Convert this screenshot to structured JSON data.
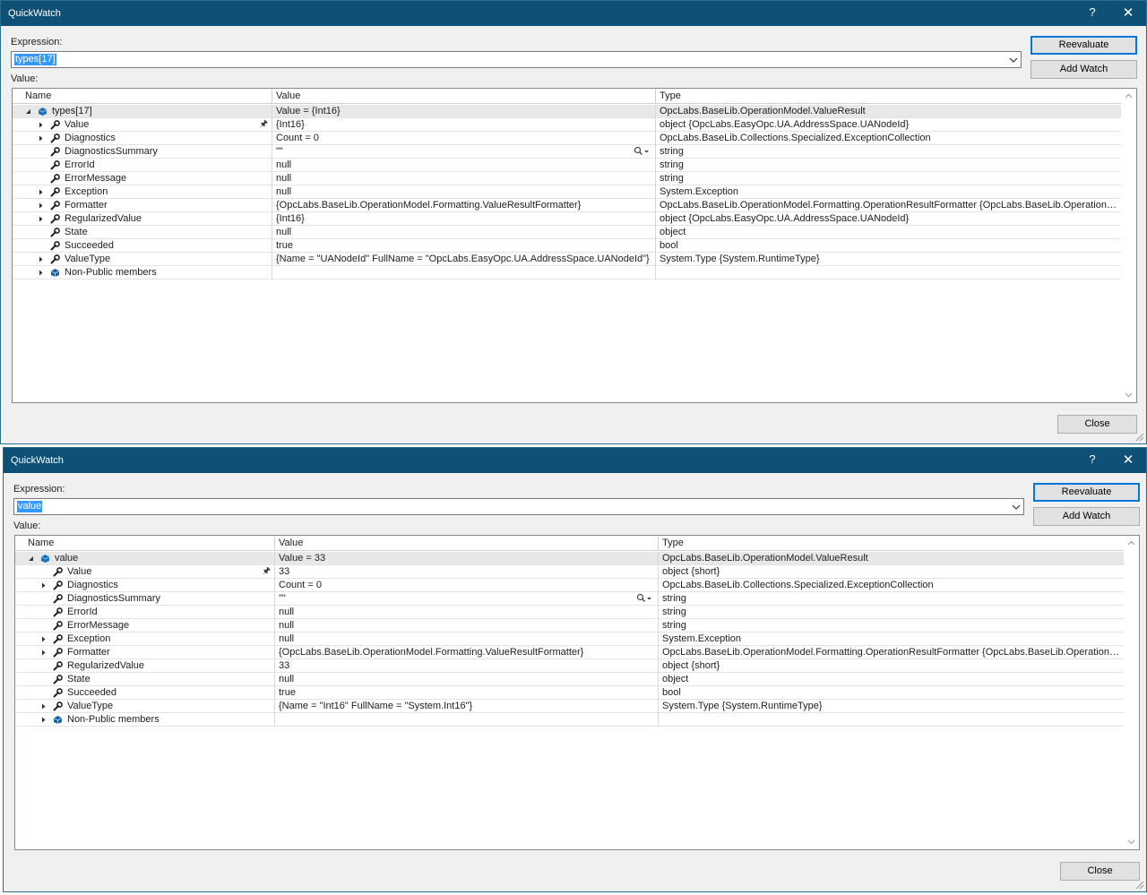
{
  "dialogs": [
    {
      "title": "QuickWatch",
      "help_label": "?",
      "close_glyph": "✕",
      "expression_label": "Expression:",
      "expression_value": "types[17]",
      "value_label": "Value:",
      "buttons": {
        "reevaluate": "Reevaluate",
        "add_watch": "Add Watch",
        "close": "Close"
      },
      "columns": [
        "Name",
        "Value",
        "Type"
      ],
      "rows": [
        {
          "indent": 0,
          "expander": "expanded",
          "icon": "object-icon",
          "name": "types[17]",
          "value": "Value = {Int16}",
          "type": "OpcLabs.BaseLib.OperationModel.ValueResult",
          "selected": true
        },
        {
          "indent": 1,
          "expander": "collapsed",
          "icon": "property-icon",
          "name": "Value",
          "value": "{Int16}",
          "type": "object {OpcLabs.EasyOpc.UA.AddressSpace.UANodeId}",
          "pin": "🖈"
        },
        {
          "indent": 1,
          "expander": "collapsed",
          "icon": "property-icon",
          "name": "Diagnostics",
          "value": "Count = 0",
          "type": "OpcLabs.BaseLib.Collections.Specialized.ExceptionCollection"
        },
        {
          "indent": 1,
          "expander": "none",
          "icon": "property-icon",
          "name": "DiagnosticsSummary",
          "value": "\"\"",
          "type": "string",
          "magnifier": true
        },
        {
          "indent": 1,
          "expander": "none",
          "icon": "property-icon",
          "name": "ErrorId",
          "value": "null",
          "type": "string"
        },
        {
          "indent": 1,
          "expander": "none",
          "icon": "property-icon",
          "name": "ErrorMessage",
          "value": "null",
          "type": "string"
        },
        {
          "indent": 1,
          "expander": "collapsed",
          "icon": "property-icon",
          "name": "Exception",
          "value": "null",
          "type": "System.Exception"
        },
        {
          "indent": 1,
          "expander": "collapsed",
          "icon": "property-icon",
          "name": "Formatter",
          "value": "{OpcLabs.BaseLib.OperationModel.Formatting.ValueResultFormatter}",
          "type": "OpcLabs.BaseLib.OperationModel.Formatting.OperationResultFormatter {OpcLabs.BaseLib.OperationModel...."
        },
        {
          "indent": 1,
          "expander": "collapsed",
          "icon": "property-icon",
          "name": "RegularizedValue",
          "value": "{Int16}",
          "type": "object {OpcLabs.EasyOpc.UA.AddressSpace.UANodeId}"
        },
        {
          "indent": 1,
          "expander": "none",
          "icon": "property-icon",
          "name": "State",
          "value": "null",
          "type": "object"
        },
        {
          "indent": 1,
          "expander": "none",
          "icon": "property-icon",
          "name": "Succeeded",
          "value": "true",
          "type": "bool"
        },
        {
          "indent": 1,
          "expander": "collapsed",
          "icon": "property-icon",
          "name": "ValueType",
          "value": "{Name = \"UANodeId\" FullName = \"OpcLabs.EasyOpc.UA.AddressSpace.UANodeId\"}",
          "type": "System.Type {System.RuntimeType}"
        },
        {
          "indent": 1,
          "expander": "collapsed",
          "icon": "members-icon",
          "name": "Non-Public members",
          "value": "",
          "type": ""
        }
      ]
    },
    {
      "title": "QuickWatch",
      "help_label": "?",
      "close_glyph": "✕",
      "expression_label": "Expression:",
      "expression_value": "value",
      "value_label": "Value:",
      "buttons": {
        "reevaluate": "Reevaluate",
        "add_watch": "Add Watch",
        "close": "Close"
      },
      "columns": [
        "Name",
        "Value",
        "Type"
      ],
      "rows": [
        {
          "indent": 0,
          "expander": "expanded",
          "icon": "object-icon",
          "name": "value",
          "value": "Value = 33",
          "type": "OpcLabs.BaseLib.OperationModel.ValueResult",
          "selected": true
        },
        {
          "indent": 1,
          "expander": "none",
          "icon": "property-icon",
          "name": "Value",
          "value": "33",
          "type": "object {short}",
          "pin": "🖈"
        },
        {
          "indent": 1,
          "expander": "collapsed",
          "icon": "property-icon",
          "name": "Diagnostics",
          "value": "Count = 0",
          "type": "OpcLabs.BaseLib.Collections.Specialized.ExceptionCollection"
        },
        {
          "indent": 1,
          "expander": "none",
          "icon": "property-icon",
          "name": "DiagnosticsSummary",
          "value": "\"\"",
          "type": "string",
          "magnifier": true
        },
        {
          "indent": 1,
          "expander": "none",
          "icon": "property-icon",
          "name": "ErrorId",
          "value": "null",
          "type": "string"
        },
        {
          "indent": 1,
          "expander": "none",
          "icon": "property-icon",
          "name": "ErrorMessage",
          "value": "null",
          "type": "string"
        },
        {
          "indent": 1,
          "expander": "collapsed",
          "icon": "property-icon",
          "name": "Exception",
          "value": "null",
          "type": "System.Exception"
        },
        {
          "indent": 1,
          "expander": "collapsed",
          "icon": "property-icon",
          "name": "Formatter",
          "value": "{OpcLabs.BaseLib.OperationModel.Formatting.ValueResultFormatter}",
          "type": "OpcLabs.BaseLib.OperationModel.Formatting.OperationResultFormatter {OpcLabs.BaseLib.OperationModel...."
        },
        {
          "indent": 1,
          "expander": "none",
          "icon": "property-icon",
          "name": "RegularizedValue",
          "value": "33",
          "type": "object {short}"
        },
        {
          "indent": 1,
          "expander": "none",
          "icon": "property-icon",
          "name": "State",
          "value": "null",
          "type": "object"
        },
        {
          "indent": 1,
          "expander": "none",
          "icon": "property-icon",
          "name": "Succeeded",
          "value": "true",
          "type": "bool"
        },
        {
          "indent": 1,
          "expander": "collapsed",
          "icon": "property-icon",
          "name": "ValueType",
          "value": "{Name = \"Int16\" FullName = \"System.Int16\"}",
          "type": "System.Type {System.RuntimeType}"
        },
        {
          "indent": 1,
          "expander": "collapsed",
          "icon": "members-icon",
          "name": "Non-Public members",
          "value": "",
          "type": ""
        }
      ]
    }
  ],
  "colors": {
    "titlebar": "#0f5176",
    "selection": "#3399ff",
    "default_button_border": "#0078d7",
    "dialog_bg": "#f0f0f0"
  }
}
